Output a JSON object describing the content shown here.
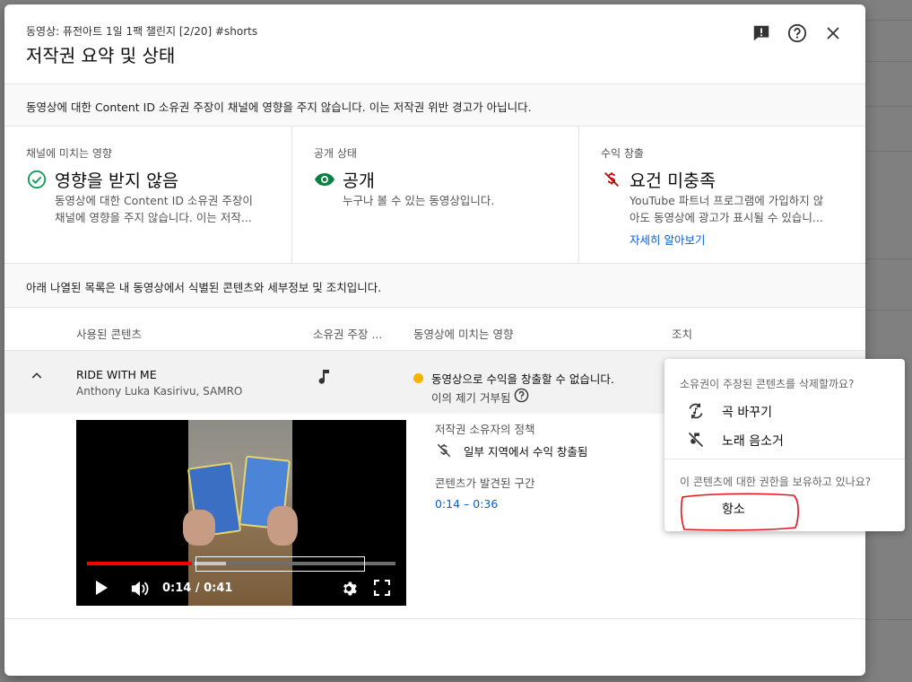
{
  "header": {
    "subtitle": "동영상: 퓨전아트 1일 1팩 챌린지 [2/20] #shorts",
    "title": "저작권 요약 및 상태"
  },
  "notice": "동영상에 대한 Content ID 소유권 주장이 채널에 영향을 주지 않습니다. 이는 저작권 위반 경고가 아닙니다.",
  "cards": [
    {
      "label": "채널에 미치는 영향",
      "icon": "check-circle-icon",
      "value": "영향을 받지 않음",
      "desc1": "동영상에 대한 Content ID 소유권 주장이",
      "desc2": "채널에 영향을 주지 않습니다. 이는 저작...",
      "color": "#0f9d58"
    },
    {
      "label": "공개 상태",
      "icon": "eye-icon",
      "value": "공개",
      "desc1": "누구나 볼 수 있는 동영상입니다.",
      "color": "#0b8043"
    },
    {
      "label": "수익 창출",
      "icon": "no-money-icon",
      "value": "요건 미충족",
      "desc1": "YouTube 파트너 프로그램에 가입하지 않",
      "desc2": "아도 동영상에 광고가 표시될 수 있습니...",
      "link": "자세히 알아보기",
      "color": "#cc0000"
    }
  ],
  "info2": "아래 나열된 목록은 내 동영상에서 식별된 콘텐츠와 세부정보 및 조치입니다.",
  "table": {
    "headers": [
      "사용된 콘텐츠",
      "소유권 주장 ...",
      "동영상에 미치는 영향",
      "조치"
    ],
    "row": {
      "song": "RIDE WITH ME",
      "artist": "Anthony Luka Kasirivu, SAMRO",
      "impact": "동영상으로 수익을 창출할 수 없습니다.",
      "dispute": "이의 제기 거부됨"
    }
  },
  "video": {
    "time": "0:14 / 0:41",
    "progress": 0.341
  },
  "details": {
    "policy_label": "저작권 소유자의 정책",
    "policy_value": "일부 지역에서 수익 창출됨",
    "segment_label": "콘텐츠가 발견된 구간",
    "segment_value": "0:14 – 0:36"
  },
  "menu": {
    "heading1": "소유권이 주장된 콘텐츠를 삭제할까요?",
    "item_replace": "곡 바꾸기",
    "item_mute": "노래 음소거",
    "heading2": "이 콘텐츠에 대한 권한을 보유하고 있나요?",
    "item_appeal": "항소"
  }
}
